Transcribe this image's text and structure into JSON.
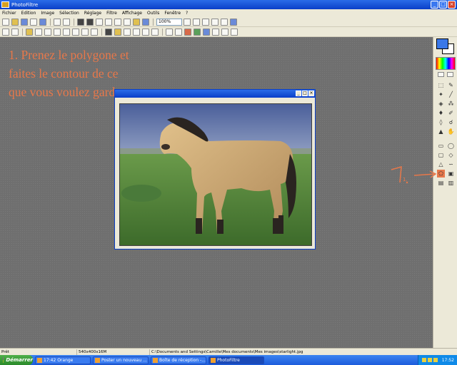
{
  "window": {
    "title": "PhotoFiltre"
  },
  "menu": [
    "Fichier",
    "Edition",
    "Image",
    "Sélection",
    "Réglage",
    "Filtre",
    "Affichage",
    "Outils",
    "Fenêtre",
    "?"
  ],
  "toolbar": {
    "zoom_value": "100%"
  },
  "annotation": {
    "lines": [
      "1. Prenez le polygone et",
      "faites le contour de ce",
      "que vous voulez garder."
    ],
    "tool_marker": "1.",
    "color": "#e8784a"
  },
  "image_window": {
    "title": ""
  },
  "status": {
    "state": "Prêt",
    "dimensions": "540x400x16M",
    "path": "C:\\Documents and Settings\\Camille\\Mes documents\\Mes images\\starlight.jpg"
  },
  "taskbar": {
    "start_label": "Démarrer",
    "tasks": [
      {
        "label": "17:42 Orange"
      },
      {
        "label": "Poster un nouveau ..."
      },
      {
        "label": "Boîte de réception -..."
      },
      {
        "label": "PhotoFiltre"
      }
    ],
    "clock": "17:52"
  },
  "colors": {
    "foreground": "#3a78e8",
    "background": "#ffffff",
    "accent": "#e8784a"
  }
}
